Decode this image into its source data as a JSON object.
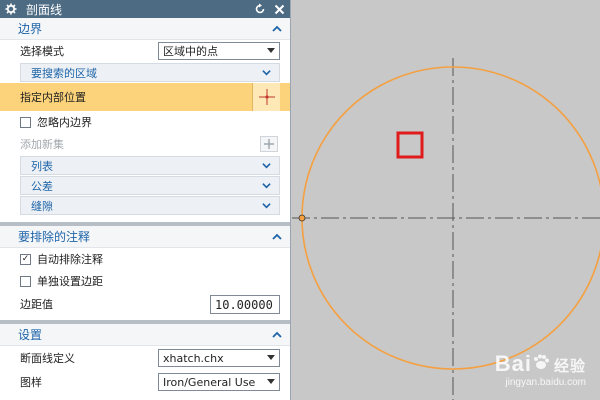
{
  "dialog": {
    "title": "剖面线",
    "boundary_section": {
      "header": "边界",
      "select_mode_label": "选择模式",
      "select_mode_value": "区域中的点",
      "region_to_search": "要搜索的区域",
      "specify_interior_location": "指定内部位置",
      "ignore_inner_boundary": "忽略内边界",
      "ignore_inner_boundary_checked": false,
      "add_new_set": "添加新集",
      "list": "列表",
      "tolerance": "公差",
      "gap": "缝隙"
    },
    "exclude_annotations_section": {
      "header": "要排除的注释",
      "auto_exclude_annotations": "自动排除注释",
      "auto_exclude_annotations_checked": true,
      "set_margin_separately": "单独设置边距",
      "set_margin_separately_checked": false,
      "margin_label": "边距值",
      "margin_value": "10.00000"
    },
    "settings_section": {
      "header": "设置",
      "section_line_def_label": "断面线定义",
      "section_line_def_value": "xhatch.chx",
      "pattern_label": "图样",
      "pattern_value": "Iron/General Use"
    }
  },
  "canvas": {
    "background_color": "#c8c8c8",
    "circle_color": "#f5a040",
    "selection_box_color": "#e01b1b"
  },
  "watermark": {
    "brand": "Bai",
    "brand_suffix": "经验",
    "url": "jingyan.baidu.com"
  }
}
